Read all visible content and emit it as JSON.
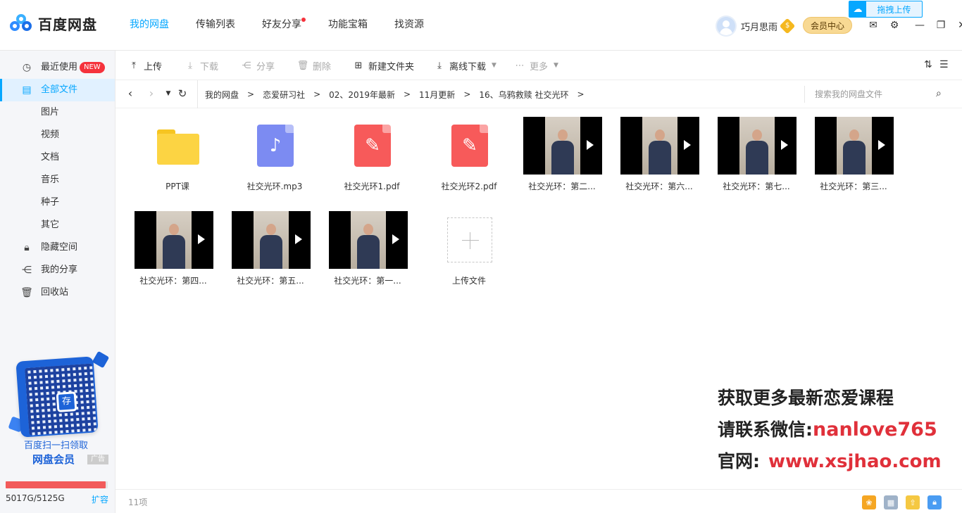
{
  "app": {
    "logo_text": "百度网盘",
    "drag_upload_label": "拖拽上传"
  },
  "topnav": {
    "tabs": [
      {
        "label": "我的网盘",
        "active": true
      },
      {
        "label": "传输列表"
      },
      {
        "label": "好友分享",
        "has_dot": true
      },
      {
        "label": "功能宝箱"
      },
      {
        "label": "找资源"
      }
    ]
  },
  "user": {
    "name": "巧月思雨",
    "coin_icon": "$",
    "member_center": "会员中心"
  },
  "sidebar": {
    "items": [
      {
        "label": "最近使用",
        "icon": "clock-icon",
        "badge": "NEW"
      },
      {
        "label": "全部文件",
        "icon": "file-icon",
        "active": true
      },
      {
        "label": "图片"
      },
      {
        "label": "视频"
      },
      {
        "label": "文档"
      },
      {
        "label": "音乐"
      },
      {
        "label": "种子"
      },
      {
        "label": "其它"
      },
      {
        "label": "隐藏空间",
        "icon": "lock-icon"
      },
      {
        "label": "我的分享",
        "icon": "share-icon"
      },
      {
        "label": "回收站",
        "icon": "trash-icon"
      }
    ],
    "promo": {
      "qr_center_text": "存",
      "line1": "百度扫一扫领取",
      "line2": "网盘会员",
      "ad_tag": "广告"
    },
    "quota": {
      "text": "5017G/5125G",
      "used_fraction": 0.979,
      "expand_label": "扩容"
    }
  },
  "toolbar": {
    "upload": "上传",
    "download": "下载",
    "share": "分享",
    "delete": "删除",
    "new_folder": "新建文件夹",
    "offline_download": "离线下载",
    "more": "更多"
  },
  "path": {
    "crumbs": [
      "我的网盘",
      "恋爱研习社",
      "02、2019年最新",
      "11月更新",
      "16、乌鸦救赎 社交光环"
    ],
    "search_placeholder": "搜索我的网盘文件"
  },
  "files": [
    {
      "name": "PPT课",
      "type": "folder"
    },
    {
      "name": "社交光环.mp3",
      "type": "mp3"
    },
    {
      "name": "社交光环1.pdf",
      "type": "pdf"
    },
    {
      "name": "社交光环2.pdf",
      "type": "pdf"
    },
    {
      "name": "社交光环：第二...",
      "type": "video"
    },
    {
      "name": "社交光环：第六...",
      "type": "video"
    },
    {
      "name": "社交光环：第七...",
      "type": "video"
    },
    {
      "name": "社交光环：第三...",
      "type": "video"
    },
    {
      "name": "社交光环：第四...",
      "type": "video"
    },
    {
      "name": "社交光环：第五...",
      "type": "video"
    },
    {
      "name": "社交光环：第一...",
      "type": "video"
    },
    {
      "name": "上传文件",
      "type": "upload"
    }
  ],
  "watermark": {
    "line1": "获取更多最新恋爱课程",
    "line2_label": "请联系微信:",
    "line2_value": "nanlove765",
    "line3_label": "官网:",
    "line3_value": "www.xsjhao.com"
  },
  "footer": {
    "count": "11项"
  },
  "colors": {
    "accent": "#06a7ff",
    "danger": "#f25b5b"
  }
}
